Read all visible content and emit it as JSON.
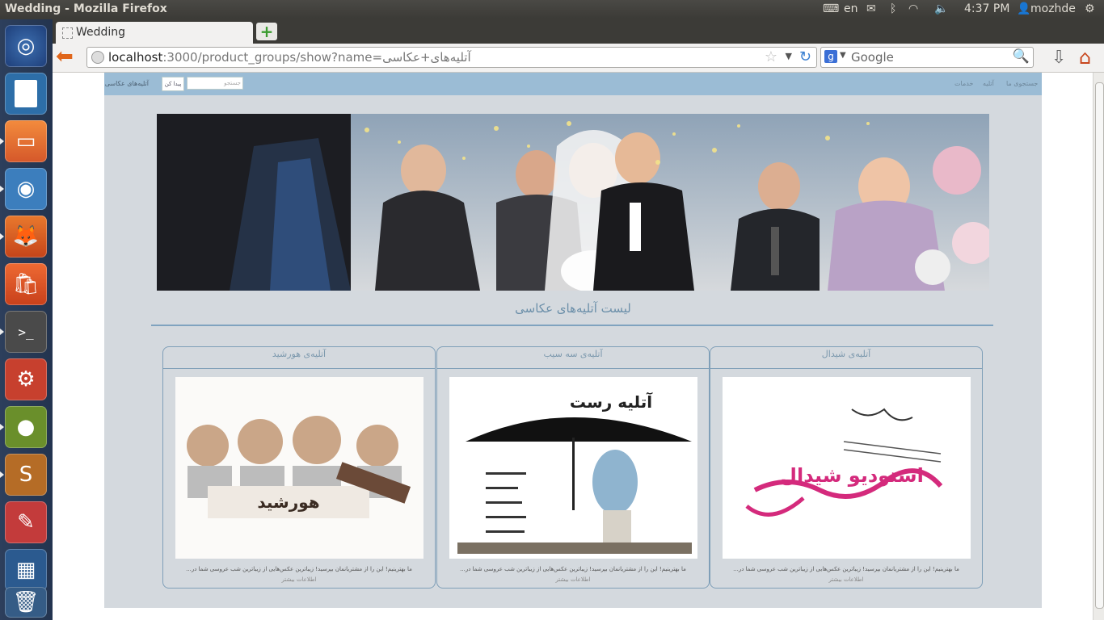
{
  "topbar": {
    "window_title": "Wedding - Mozilla Firefox",
    "keyboard_layout": "en",
    "time": "4:37 PM",
    "user": "mozhde"
  },
  "browser": {
    "tab_title": "Wedding",
    "url_host": "localhost",
    "url_path": ":3000/product_groups/show?name=آتلیه‌های+عکاسی",
    "search_placeholder": "Google"
  },
  "launcher": {
    "items": [
      "dash-home",
      "libreoffice-writer",
      "files",
      "chromium",
      "firefox",
      "ubuntu-software-center",
      "terminal",
      "system-settings",
      "tor-browser",
      "sublime-text",
      "document-viewer",
      "workspace-switcher",
      "trash"
    ]
  },
  "site": {
    "brand": "آتلیه‌های عکاسی",
    "search_button": "پیدا کن",
    "search_placeholder": "جستجو",
    "nav": [
      "جستجوی ما",
      "آتلیه",
      "خدمات"
    ],
    "page_heading": "لیست آتلیه‌های عکاسی",
    "cards": [
      {
        "title": "آتلیه‌ی هورشید",
        "desc": "ما بهترینیم! این را از مشتریانمان بپرسید! زیباترین عکس‌هایی از زیباترین شب عروسی شما در...",
        "more": "اطلاعات بیشتر",
        "logo_text": "هورشید"
      },
      {
        "title": "آتلیه‌ی سه سیب",
        "desc": "ما بهترینیم! این را از مشتریانمان بپرسید! زیباترین عکس‌هایی از زیباترین شب عروسی شما در...",
        "more": "اطلاعات بیشتر",
        "logo_text": "آتلیه رست"
      },
      {
        "title": "آتلیه‌ی شیدال",
        "desc": "ما بهترینیم! این را از مشتریانمان بپرسید! زیباترین عکس‌هایی از زیباترین شب عروسی شما در...",
        "more": "اطلاعات بیشتر",
        "logo_text": "استودیو شیدال"
      }
    ]
  }
}
